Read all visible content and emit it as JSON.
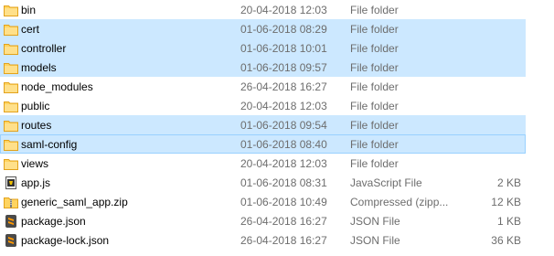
{
  "files": [
    {
      "name": "bin",
      "date": "20-04-2018 12:03",
      "type": "File folder",
      "size": "",
      "icon": "folder-icon",
      "state": "normal"
    },
    {
      "name": "cert",
      "date": "01-06-2018 08:29",
      "type": "File folder",
      "size": "",
      "icon": "folder-icon",
      "state": "selected"
    },
    {
      "name": "controller",
      "date": "01-06-2018 10:01",
      "type": "File folder",
      "size": "",
      "icon": "folder-icon",
      "state": "selected"
    },
    {
      "name": "models",
      "date": "01-06-2018 09:57",
      "type": "File folder",
      "size": "",
      "icon": "folder-icon",
      "state": "selected"
    },
    {
      "name": "node_modules",
      "date": "26-04-2018 16:27",
      "type": "File folder",
      "size": "",
      "icon": "folder-icon",
      "state": "normal"
    },
    {
      "name": "public",
      "date": "20-04-2018 12:03",
      "type": "File folder",
      "size": "",
      "icon": "folder-icon",
      "state": "normal"
    },
    {
      "name": "routes",
      "date": "01-06-2018 09:54",
      "type": "File folder",
      "size": "",
      "icon": "folder-icon",
      "state": "selected"
    },
    {
      "name": "saml-config",
      "date": "01-06-2018 08:40",
      "type": "File folder",
      "size": "",
      "icon": "folder-icon",
      "state": "focused"
    },
    {
      "name": "views",
      "date": "20-04-2018 12:03",
      "type": "File folder",
      "size": "",
      "icon": "folder-icon",
      "state": "normal"
    },
    {
      "name": "app.js",
      "date": "01-06-2018 08:31",
      "type": "JavaScript File",
      "size": "2 KB",
      "icon": "javascript-file-icon",
      "state": "normal"
    },
    {
      "name": "generic_saml_app.zip",
      "date": "01-06-2018 10:49",
      "type": "Compressed (zipp...",
      "size": "12 KB",
      "icon": "zip-archive-icon",
      "state": "normal"
    },
    {
      "name": "package.json",
      "date": "26-04-2018 16:27",
      "type": "JSON File",
      "size": "1 KB",
      "icon": "sublime-json-icon",
      "state": "normal"
    },
    {
      "name": "package-lock.json",
      "date": "26-04-2018 16:27",
      "type": "JSON File",
      "size": "36 KB",
      "icon": "sublime-json-icon",
      "state": "normal"
    }
  ],
  "colors": {
    "selection": "#cce8ff",
    "focus_border": "#99d1ff",
    "folder": "#ffd460",
    "secondary_text": "#6d6d6d"
  }
}
